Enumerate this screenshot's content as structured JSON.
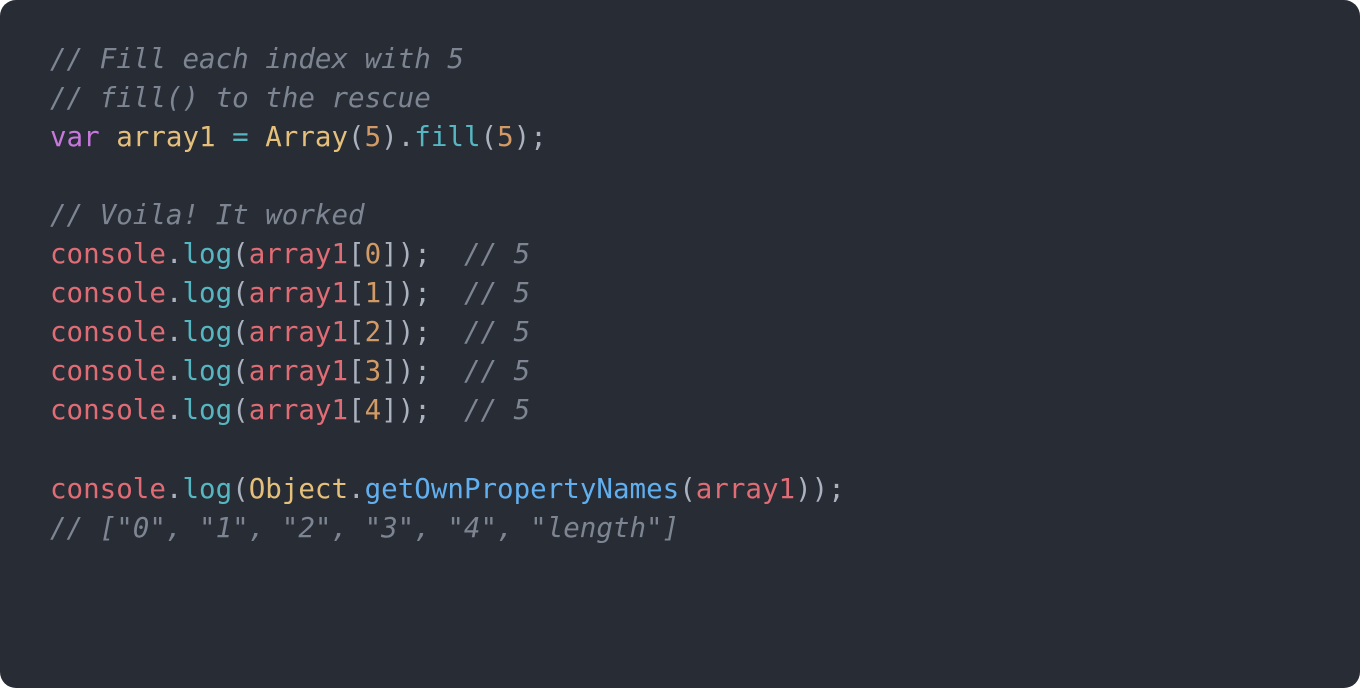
{
  "code": {
    "lines": [
      {
        "type": "comment",
        "text": "// Fill each index with 5"
      },
      {
        "type": "comment",
        "text": "// fill() to the rescue"
      },
      {
        "type": "vardecl",
        "keyword": "var",
        "name": "array1",
        "eq": " = ",
        "cls": "Array",
        "lp1": "(",
        "arg1": "5",
        "rp1": ")",
        "dot1": ".",
        "m1": "fill",
        "lp2": "(",
        "arg2": "5",
        "rp2": ")",
        "semi": ";"
      },
      {
        "type": "blank",
        "text": ""
      },
      {
        "type": "comment",
        "text": "// Voila! It worked"
      },
      {
        "type": "log",
        "obj": "console",
        "dot": ".",
        "fn": "log",
        "lp": "(",
        "arr": "array1",
        "lb": "[",
        "idx": "0",
        "rb": "]",
        "rp": ")",
        "semi": ";",
        "sp": "  ",
        "trail": "// 5"
      },
      {
        "type": "log",
        "obj": "console",
        "dot": ".",
        "fn": "log",
        "lp": "(",
        "arr": "array1",
        "lb": "[",
        "idx": "1",
        "rb": "]",
        "rp": ")",
        "semi": ";",
        "sp": "  ",
        "trail": "// 5"
      },
      {
        "type": "log",
        "obj": "console",
        "dot": ".",
        "fn": "log",
        "lp": "(",
        "arr": "array1",
        "lb": "[",
        "idx": "2",
        "rb": "]",
        "rp": ")",
        "semi": ";",
        "sp": "  ",
        "trail": "// 5"
      },
      {
        "type": "log",
        "obj": "console",
        "dot": ".",
        "fn": "log",
        "lp": "(",
        "arr": "array1",
        "lb": "[",
        "idx": "3",
        "rb": "]",
        "rp": ")",
        "semi": ";",
        "sp": "  ",
        "trail": "// 5"
      },
      {
        "type": "log",
        "obj": "console",
        "dot": ".",
        "fn": "log",
        "lp": "(",
        "arr": "array1",
        "lb": "[",
        "idx": "4",
        "rb": "]",
        "rp": ")",
        "semi": ";",
        "sp": "  ",
        "trail": "// 5"
      },
      {
        "type": "blank",
        "text": ""
      },
      {
        "type": "log2",
        "obj": "console",
        "dot": ".",
        "fn": "log",
        "lp": "(",
        "cls": "Object",
        "dot2": ".",
        "m": "getOwnPropertyNames",
        "lp2": "(",
        "arg": "array1",
        "rp2": ")",
        "rp": ")",
        "semi": ";"
      },
      {
        "type": "comment",
        "text": "// [\"0\", \"1\", \"2\", \"3\", \"4\", \"length\"]"
      }
    ]
  }
}
